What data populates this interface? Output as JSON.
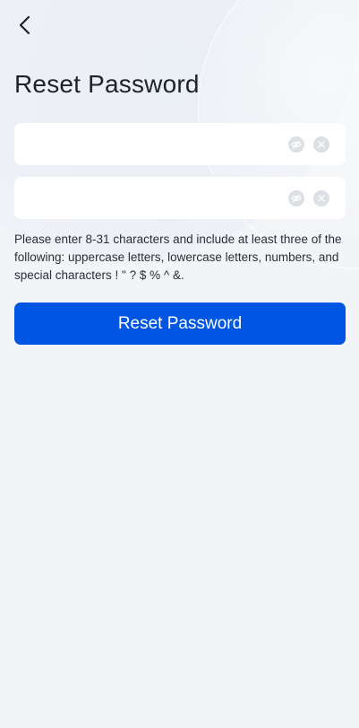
{
  "header": {
    "back_icon": "chevron-left-icon"
  },
  "page": {
    "title": "Reset Password"
  },
  "form": {
    "new_password": {
      "value": "",
      "placeholder": "",
      "visibility_icon": "eye-off-icon",
      "clear_icon": "clear-icon"
    },
    "confirm_password": {
      "value": "",
      "placeholder": "",
      "visibility_icon": "eye-off-icon",
      "clear_icon": "clear-icon"
    },
    "hint": "Please enter 8-31 characters and include at least three of the following: uppercase letters, lowercase letters, numbers, and special characters ! \" ? $ % ^ &."
  },
  "actions": {
    "submit_label": "Reset Password"
  },
  "colors": {
    "primary": "#0055e3",
    "background": "#f2f4f7",
    "field_bg": "#ffffff",
    "icon_bg": "#dcdfe4"
  }
}
